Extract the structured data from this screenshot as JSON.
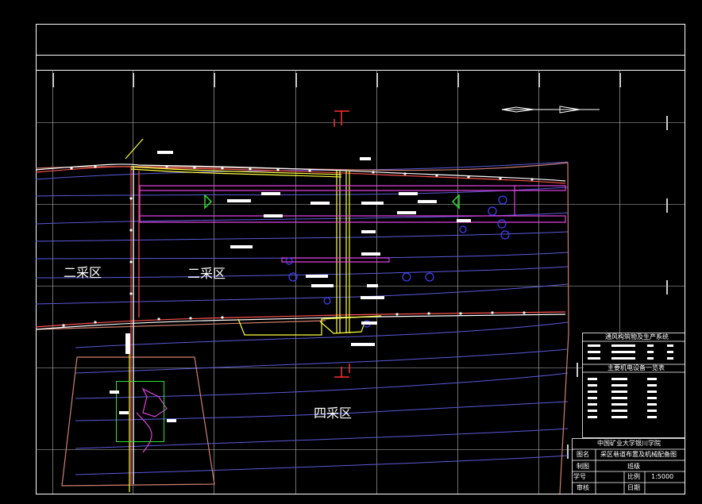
{
  "regions": {
    "west_1": "二采区",
    "west_2": "二采区",
    "south": "四采区"
  },
  "title_block": {
    "school": "中国矿业大学银川学院",
    "name_label": "图名",
    "drawing_name": "采区巷道布置及机械配备图",
    "scale_label": "比例",
    "scale": "1:5000",
    "draw_label": "制图",
    "check_label": "班级",
    "student_label": "学号",
    "date_label": "日期",
    "review_label": "审核"
  },
  "tables": {
    "vent_title": "通风构筑物及生产系统",
    "equip_title": "主要机电设备一览表"
  },
  "colors": {
    "frame": "#ffffff",
    "contour": "#5a5adc",
    "roadway_magenta": "#e040e0",
    "roadway_yellow": "#ffff40",
    "roadway_red": "#ff5050",
    "boundary_brown": "#d08070",
    "green": "#30e030",
    "equipment_blue": "#4040ff"
  }
}
